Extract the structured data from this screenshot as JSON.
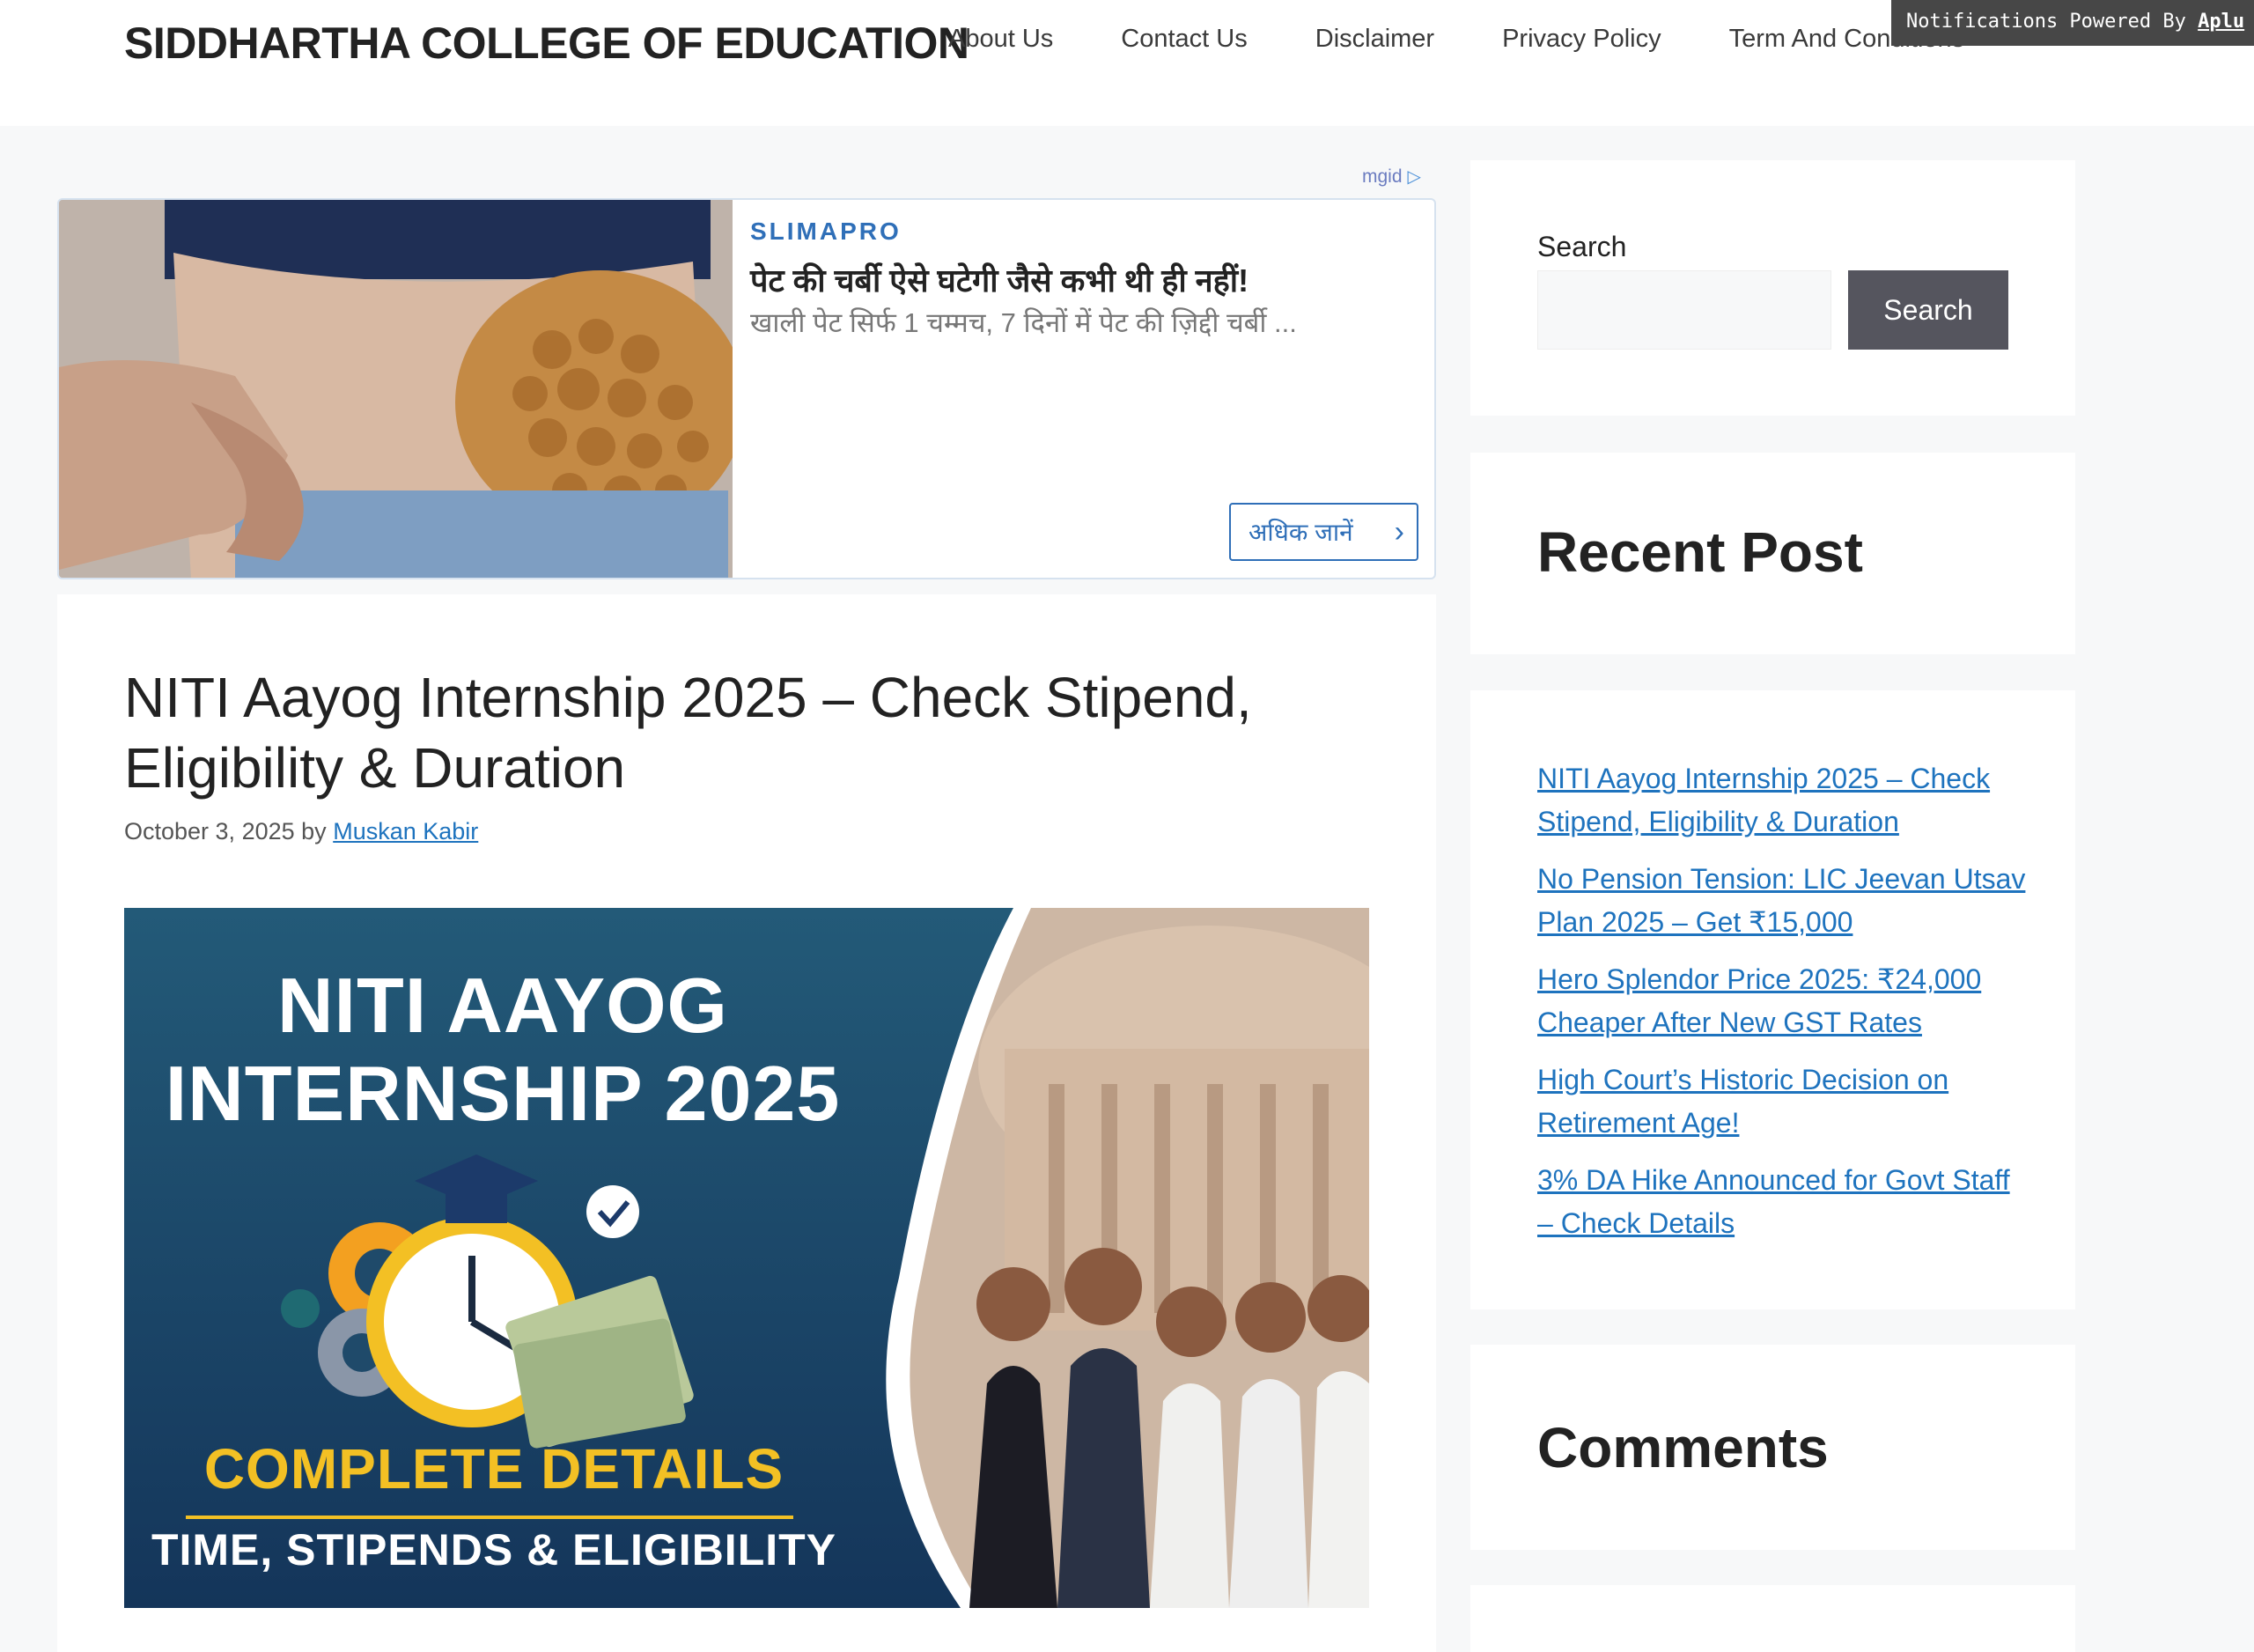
{
  "header": {
    "site_title": "SIDDHARTHA COLLEGE OF EDUCATION",
    "nav": [
      "About Us",
      "Contact Us",
      "Disclaimer",
      "Privacy Policy",
      "Term And Conditions"
    ],
    "notification_text": "Notifications Powered By ",
    "notification_brand": "Aplu"
  },
  "ad": {
    "network": "mgid",
    "brand": "SLIMAPRO",
    "headline": "पेट की चर्बी ऐसे घटेगी जैसे कभी थी ही नहीं!",
    "subtext": "खाली पेट सिर्फ 1 चम्मच, 7 दिनों में पेट की ज़िद्दी चर्बी ...",
    "cta": "अधिक जानें"
  },
  "article": {
    "title": "NITI Aayog Internship 2025 – Check Stipend, Eligibility & Duration",
    "date": "October 3, 2025",
    "by": "by",
    "author": "Muskan Kabir",
    "image": {
      "line1": "NITI AAYOG",
      "line2": "INTERNSHIP 2025",
      "line3": "COMPLETE DETAILS",
      "line4": "TIME, STIPENDS & ELIGIBILITY"
    }
  },
  "sidebar": {
    "search_label": "Search",
    "search_value": "",
    "search_button": "Search",
    "recent_title": "Recent Post",
    "recent_posts": [
      "NITI Aayog Internship 2025 – Check Stipend, Eligibility & Duration",
      "No Pension Tension: LIC Jeevan Utsav Plan 2025 – Get ₹15,000",
      "Hero Splendor Price 2025: ₹24,000 Cheaper After New GST Rates",
      "High Court’s Historic Decision on Retirement Age!",
      "3% DA Hike Announced for Govt Staff – Check Details"
    ],
    "comments_title": "Comments"
  },
  "colors": {
    "link": "#1e73be",
    "button": "#55555e",
    "ad_accent": "#2f6fb8",
    "image_gold": "#f3c024"
  }
}
